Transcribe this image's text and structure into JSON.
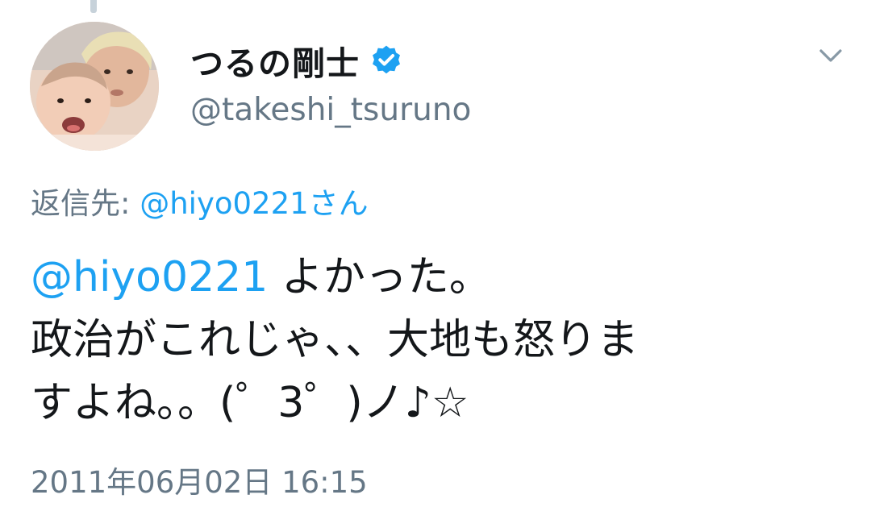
{
  "author": {
    "display_name": "つるの剛士",
    "handle": "@takeshi_tsuruno",
    "verified": true
  },
  "reply_to": {
    "prefix": "返信先:",
    "target": "@hiyo0221さん"
  },
  "tweet": {
    "mention": "@hiyo0221",
    "line1_rest": " よかった。",
    "line2": "政治がこれじゃ、、大地も怒りま",
    "line3": "すよね。。(゜3゜)ノ♪☆"
  },
  "timestamp": "2011年06月02日 16:15",
  "colors": {
    "link": "#1da1f2",
    "muted": "#657786",
    "text": "#14171a"
  },
  "icons": {
    "verified": "verified-badge-icon",
    "menu": "chevron-down-icon"
  }
}
